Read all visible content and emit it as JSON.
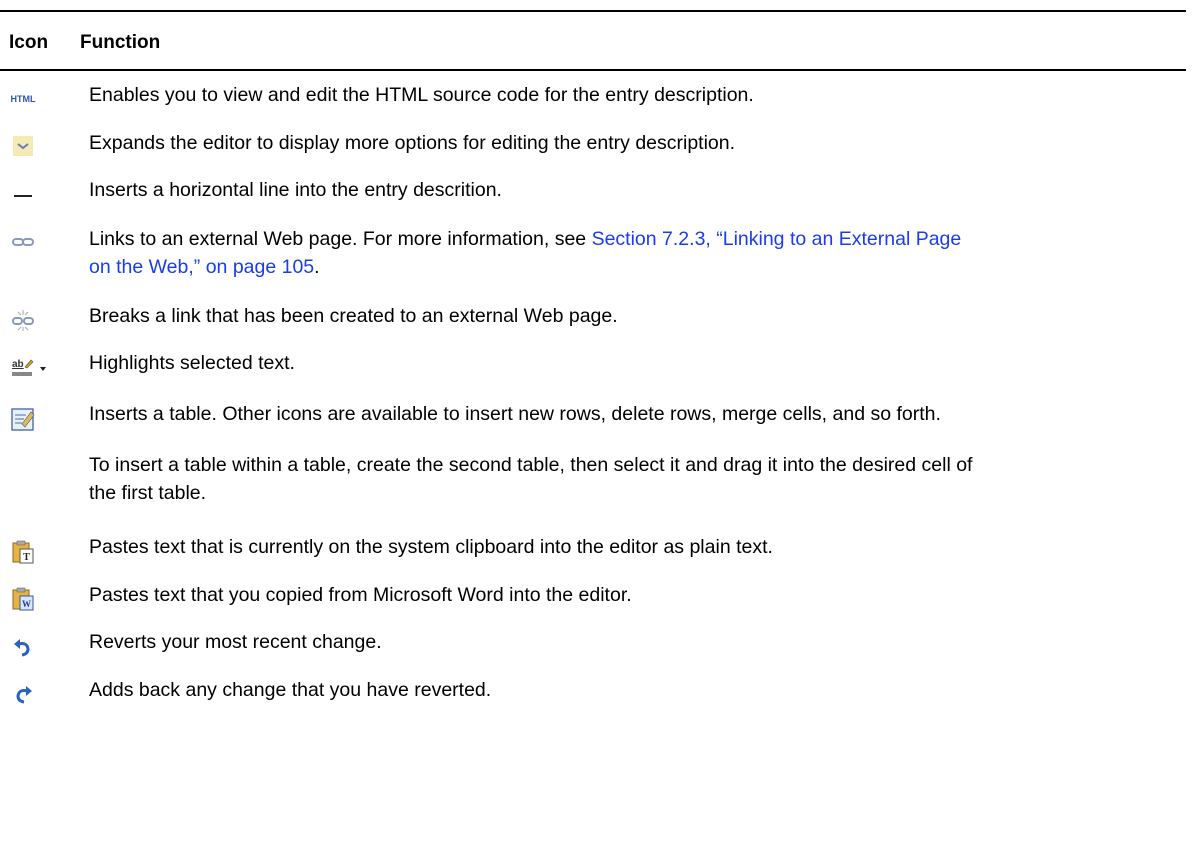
{
  "header": {
    "col_icon": "Icon",
    "col_function": "Function"
  },
  "rows": [
    {
      "icon": "html-source-icon",
      "icon_text": "HTML",
      "text": "Enables you to view and edit the HTML source code for the entry description."
    },
    {
      "icon": "expand-editor-icon",
      "text": "Expands the editor to display more options for editing the entry description."
    },
    {
      "icon": "horizontal-line-icon",
      "text": "Inserts a horizontal line into the entry descrition."
    },
    {
      "icon": "link-icon",
      "text_before": "Links to an external Web page. For more information, see ",
      "link_line1": "Section 7.2.3, “Linking to an External Page",
      "link_line2": "on the Web,” on page 105",
      "text_after": "."
    },
    {
      "icon": "unlink-icon",
      "text": "Breaks a link that has been created to an external Web page."
    },
    {
      "icon": "highlight-icon",
      "icon_text": "ab",
      "text": "Highlights selected text."
    },
    {
      "icon": "table-icon",
      "text": "Inserts a table. Other icons are available to insert new rows, delete rows, merge cells, and so forth.",
      "note_line1": "To insert a table within a table, create the second table, then select it and drag it into the desired cell of",
      "note_line2": "the first table."
    },
    {
      "icon": "paste-plain-text-icon",
      "icon_text": "T",
      "text": "Pastes text that is currently on the system clipboard into the editor as plain text."
    },
    {
      "icon": "paste-from-word-icon",
      "icon_text": "W",
      "text": "Pastes text that you copied from Microsoft Word into the editor."
    },
    {
      "icon": "undo-icon",
      "text": "Reverts your most recent change."
    },
    {
      "icon": "redo-icon",
      "text": "Adds back any change that you have reverted."
    }
  ],
  "colors": {
    "link": "#1a3cf0",
    "text": "#000000",
    "rule": "#000000"
  }
}
